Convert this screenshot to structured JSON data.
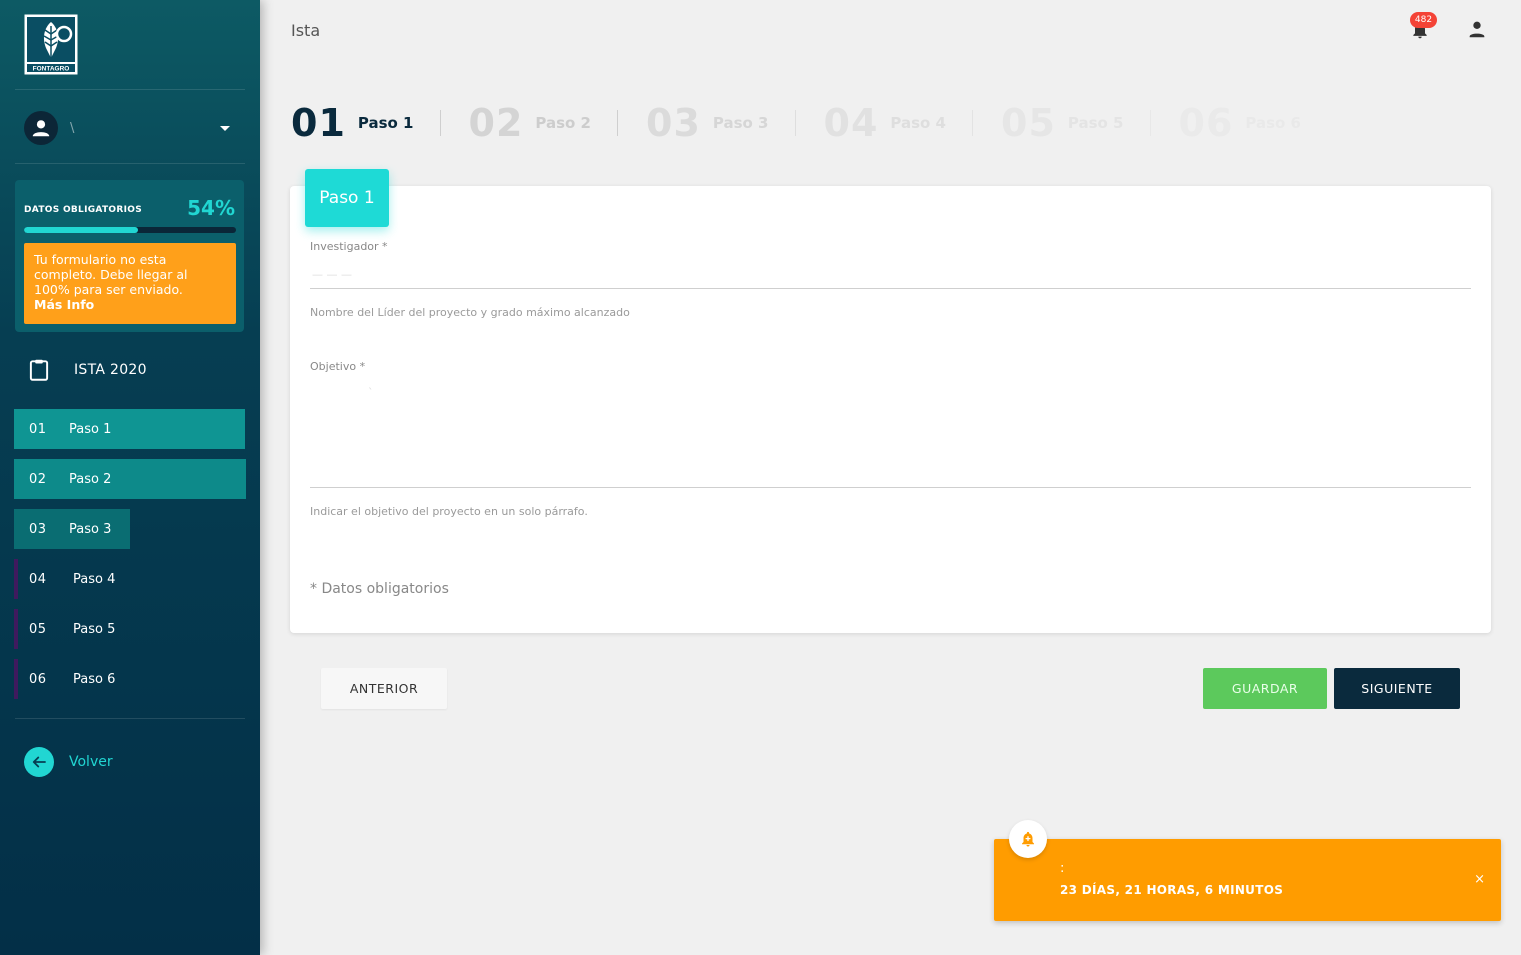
{
  "header": {
    "title": "Ista",
    "notifications_count": "482"
  },
  "sidebar": {
    "logo_text": "FONTAGRO",
    "user_name": "\\",
    "progress": {
      "label": "DATOS OBLIGATORIOS",
      "percent_text": "54%",
      "percent": 54,
      "warning_text": "Tu formulario no esta completo. Debe llegar al 100% para ser enviado.",
      "warning_link": "Más Info"
    },
    "project": {
      "label": "ISTA 2020",
      "icon": "clipboard-icon"
    },
    "steps": [
      {
        "num": "01",
        "label": "Paso 1",
        "state": "active"
      },
      {
        "num": "02",
        "label": "Paso 2",
        "state": "done"
      },
      {
        "num": "03",
        "label": "Paso 3",
        "state": "done"
      },
      {
        "num": "04",
        "label": "Paso 4",
        "state": "todo"
      },
      {
        "num": "05",
        "label": "Paso 5",
        "state": "todo"
      },
      {
        "num": "06",
        "label": "Paso 6",
        "state": "todo"
      }
    ],
    "back_label": "Volver"
  },
  "stepper": [
    {
      "num": "01",
      "label": "Paso 1"
    },
    {
      "num": "02",
      "label": "Paso 2"
    },
    {
      "num": "03",
      "label": "Paso 3"
    },
    {
      "num": "04",
      "label": "Paso 4"
    },
    {
      "num": "05",
      "label": "Paso 5"
    },
    {
      "num": "06",
      "label": "Paso 6"
    }
  ],
  "form": {
    "tab_label": "Paso 1",
    "investigador": {
      "label": "Investigador *",
      "value": "— — —",
      "help": "Nombre del Líder del proyecto y grado máximo alcanzado"
    },
    "objetivo": {
      "label": "Objetivo *",
      "value": "`",
      "help": "Indicar el objetivo del proyecto en un solo párrafo."
    },
    "required_note": "* Datos obligatorios"
  },
  "buttons": {
    "prev": "ANTERIOR",
    "save": "GUARDAR",
    "next": "SIGUIENTE"
  },
  "toast": {
    "title": ":",
    "message": "23 DÍAS, 21 HORAS, 6 MINUTOS",
    "close": "×",
    "icon": "bell-plus-icon"
  },
  "colors": {
    "accent": "#21d6d2",
    "warning": "#ffa01a",
    "save": "#5cc95c",
    "dark": "#0a2a3d"
  }
}
